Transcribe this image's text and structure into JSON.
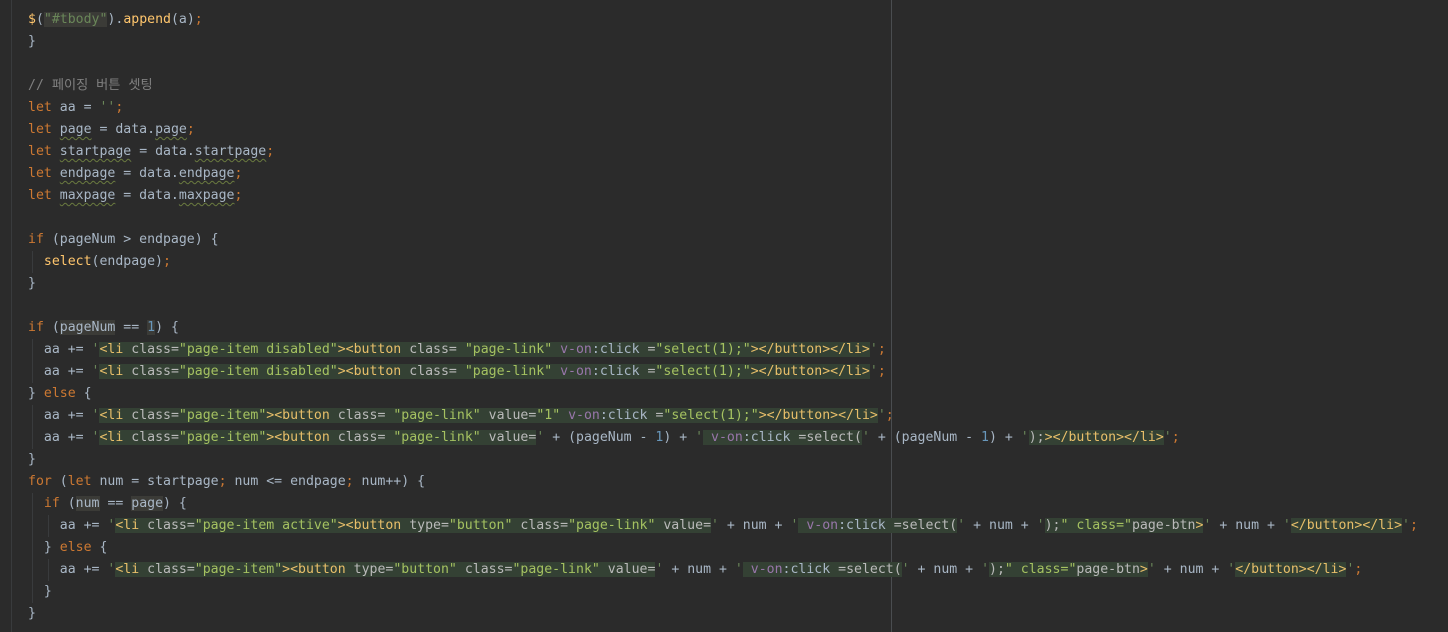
{
  "editor": {
    "language": "javascript",
    "theme": "darcula",
    "lines": [
      "$(\"#tbody\").append(a);",
      "}",
      "",
      "// 페이징 버튼 셋팅",
      "let aa = '';",
      "let page = data.page;",
      "let startpage = data.startpage;",
      "let endpage = data.endpage;",
      "let maxpage = data.maxpage;",
      "",
      "if (pageNum > endpage) {",
      "  select(endpage);",
      "}",
      "",
      "if (pageNum == 1) {",
      "  aa += '<li class=\"page-item disabled\"><button class= \"page-link\" v-on:click =\"select(1);\"><<</button></li>';",
      "  aa += '<li class=\"page-item disabled\"><button class= \"page-link\" v-on:click =\"select(1);\"><</button></li>';",
      "} else {",
      "  aa += '<li class=\"page-item\"><button class= \"page-link\" value=\"1\" v-on:click =\"select(1);\"><<</button></li>';",
      "  aa += '<li class=\"page-item\"><button class= \"page-link\" value=' + (pageNum - 1) + ' v-on:click =\"select(' + (pageNum - 1) + ');\"><</button></li>';",
      "}",
      "for (let num = startpage; num <= endpage; num++) {",
      "  if (num == page) {",
      "    aa += '<li class=\"page-item active\"><button type=\"button\" class=\"page-link\" value=' + num + ' v-on:click =\"select(' + num + ');\" class=\"page-btn\">' + num + '</button></li>';",
      "  } else {",
      "    aa += '<li class=\"page-item\"><button type=\"button\" class=\"page-link\" value=' + num + ' v-on:click =\"select(' + num + ');\" class=\"page-btn\">' + num + '</button></li>';",
      "  }",
      "}"
    ]
  },
  "colors": {
    "background": "#2b2b2b",
    "keyword": "#cc7832",
    "function": "#ffc66d",
    "string": "#6a8759",
    "comment": "#808080",
    "number": "#6897bb",
    "html_injection_bg": "#344134"
  }
}
